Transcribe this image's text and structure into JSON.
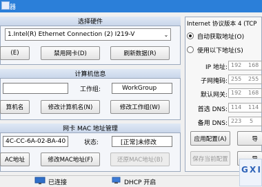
{
  "window": {
    "title": "器"
  },
  "hardware": {
    "header": "选择硬件",
    "selected_adapter": "1.Intel(R) Ethernet Connection (2) I219-V",
    "btn_left": "(E)",
    "btn_disable": "禁用网卡(D)",
    "btn_refresh": "刷新数据(R)"
  },
  "computer": {
    "header": "计算机信息",
    "name_value": "",
    "workgroup_label": "工作组:",
    "workgroup_value": "WorkGroup",
    "btn_left": "算机名",
    "btn_modify_name": "修改计算机名(N)",
    "btn_modify_workgroup": "修改工作组(W)"
  },
  "mac": {
    "header": "网卡 MAC 地址管理",
    "address": "4C-CC-6A-02-BA-40",
    "status_label": "状态:",
    "status_value": "[正常]未修改",
    "btn_left": "AC地址",
    "btn_modify": "修改MAC地址(F)",
    "btn_restore": "还原MAC地址(B)"
  },
  "ipv4": {
    "header": "Internet 协议版本 4 (TCP",
    "radio_auto": "自动获取地址(O)",
    "radio_manual": "使用以下地址(S)",
    "selected": "auto",
    "fields": [
      {
        "label": "IP 地址:",
        "o1": "192",
        "o2": "168"
      },
      {
        "label": "子网掩码:",
        "o1": "255",
        "o2": "255"
      },
      {
        "label": "默认网关:",
        "o1": "192",
        "o2": "168"
      },
      {
        "label": "首选 DNS:",
        "o1": "114",
        "o2": "114"
      },
      {
        "label": "备用 DNS:",
        "o1": "223",
        "o2": "5"
      }
    ],
    "btn_apply": "应用配置(A)",
    "btn_right1": "导",
    "btn_save": "保存当前配置",
    "btn_right2": "导"
  },
  "status": {
    "connected": "已连接",
    "dhcp": "DHCP 开启"
  },
  "watermark": {
    "text": "G X I"
  }
}
